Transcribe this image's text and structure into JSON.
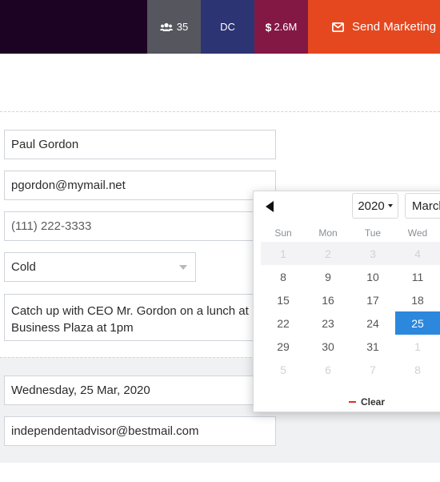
{
  "topbar": {
    "users_count": "35",
    "region": "DC",
    "revenue": "2.6M",
    "revenue_symbol": "$",
    "send_label": "Send Marketing Le",
    "colors": {
      "background": "#1d0323",
      "users": "#56565e",
      "region": "#2d3474",
      "revenue": "#831845",
      "send": "#e5471f"
    }
  },
  "form": {
    "name": "Paul Gordon",
    "email": "pgordon@mymail.net",
    "phone": "(111) 222-3333",
    "status": "Cold",
    "notes_line1": "Catch up with CEO Mr. Gordon on a lunch at",
    "notes_line2": "Business Plaza at 1pm",
    "date": "Wednesday, 25 Mar, 2020",
    "advisor_email": "independentadvisor@bestmail.com"
  },
  "datepicker": {
    "year": "2020",
    "month": "March",
    "weekdays": [
      "Sun",
      "Mon",
      "Tue",
      "Wed"
    ],
    "rows": [
      [
        "1",
        "2",
        "3",
        "4"
      ],
      [
        "8",
        "9",
        "10",
        "11"
      ],
      [
        "15",
        "16",
        "17",
        "18"
      ],
      [
        "22",
        "23",
        "24",
        "25"
      ],
      [
        "29",
        "30",
        "31",
        "1"
      ],
      [
        "5",
        "6",
        "7",
        "8"
      ]
    ],
    "selected": "25",
    "clear_label": "Clear",
    "accent_color": "#2b88dd"
  }
}
